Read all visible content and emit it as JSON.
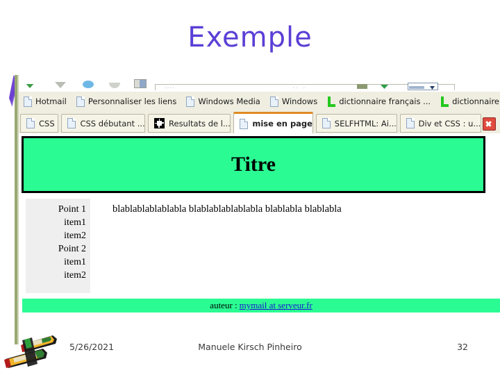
{
  "slide": {
    "title": "Exemple",
    "title_color": "#5b3fd6",
    "footer": {
      "date": "5/26/2021",
      "author": "Manuele Kirsch Pinheiro",
      "page_number": "32"
    },
    "decorations": {
      "purple_sliver": "purple-arrow-sliver",
      "pencils": "crossed-pencils-clipart",
      "left_rule_color": "#9aa874"
    }
  },
  "browser": {
    "toolbar": {
      "icons": [
        "back-arrow-icon",
        "forward-arrow-icon",
        "refresh-icon",
        "stop-icon",
        "home-icon"
      ],
      "address_bar_hint": "....",
      "address_bar_hint2": ".. .",
      "go_button": "go-button",
      "search_box": "search-box"
    },
    "bookmarks": [
      {
        "label": "Hotmail",
        "icon": "document-icon"
      },
      {
        "label": "Personnaliser les liens",
        "icon": "document-icon"
      },
      {
        "label": "Windows Media",
        "icon": "document-icon"
      },
      {
        "label": "Windows",
        "icon": "document-icon"
      },
      {
        "label": "dictionnaire français ...",
        "icon": "l-logo-icon"
      },
      {
        "label": "dictionnaire anglais fr...",
        "icon": "l-logo-icon"
      }
    ],
    "bookmarks_overflow": "»",
    "tabs": [
      {
        "label": "CSS",
        "icon": "document-icon",
        "active": false
      },
      {
        "label": "CSS débutant ...",
        "icon": "document-icon",
        "active": false
      },
      {
        "label": "Resultats de l...",
        "icon": "puzzle-icon",
        "active": false
      },
      {
        "label": "mise en page",
        "icon": "document-icon",
        "active": true
      },
      {
        "label": "SELFHTML: Ai...",
        "icon": "document-icon",
        "active": false
      },
      {
        "label": "Div et CSS : u...",
        "icon": "document-icon",
        "active": false
      }
    ],
    "close_button": "close-tab-button"
  },
  "webpage": {
    "header_title": "Titre",
    "header_bg": "#2bfb93",
    "menu": [
      {
        "label": "Point 1",
        "level": 0
      },
      {
        "label": "item1",
        "level": 1
      },
      {
        "label": "item2",
        "level": 1
      },
      {
        "label": "Point 2",
        "level": 0
      },
      {
        "label": "item1",
        "level": 1
      },
      {
        "label": "item2",
        "level": 1
      }
    ],
    "body_text": "blablablablablabla blablablablablabla blablabla blablabla",
    "footer_label": "auteur :",
    "footer_link": "mymail at serveur.fr",
    "footer_bg": "#2bfb93",
    "link_color": "#1a1ad0"
  }
}
